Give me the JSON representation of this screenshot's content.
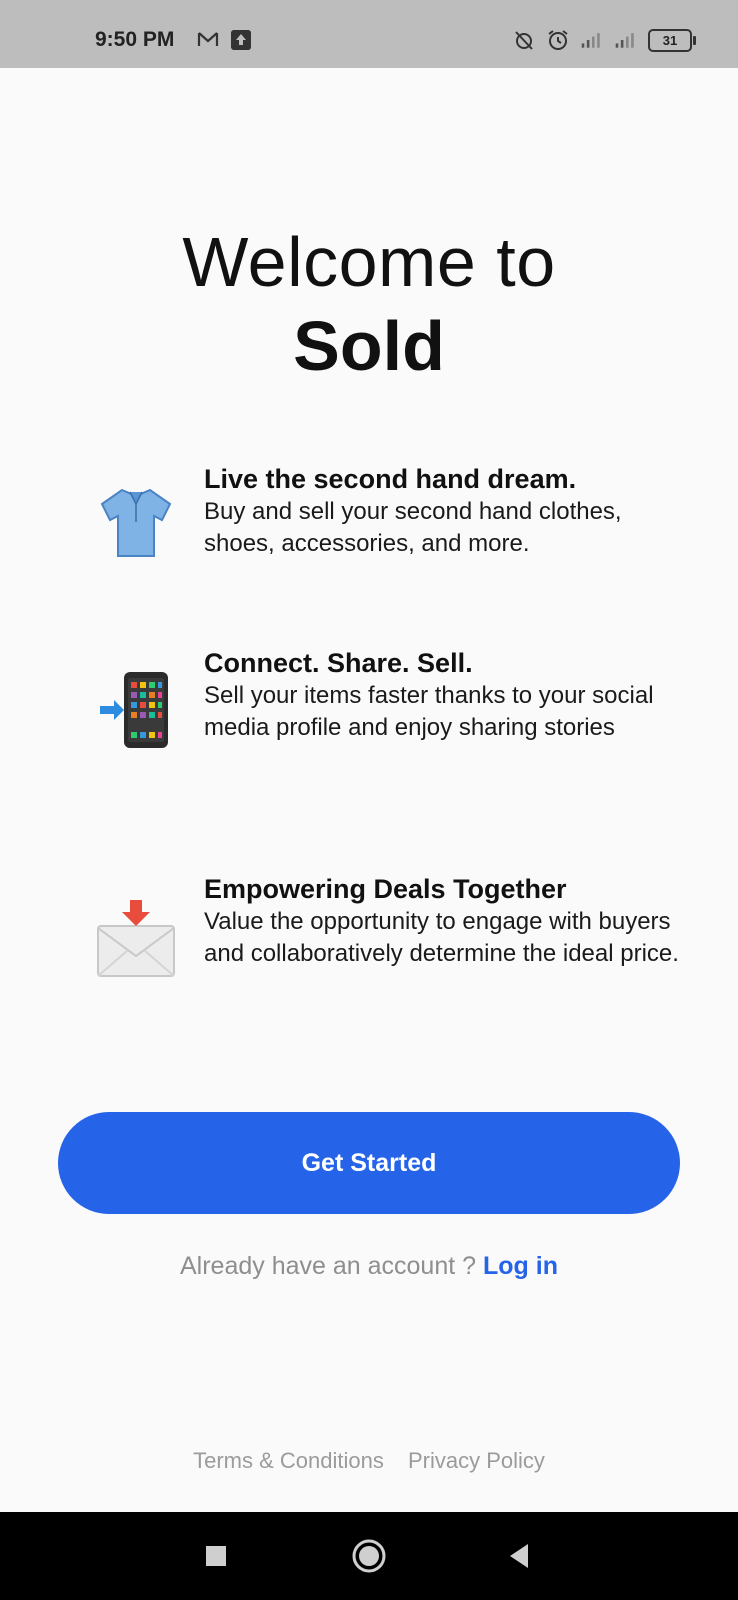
{
  "status_bar": {
    "time": "9:50 PM",
    "battery": "31",
    "icons": [
      "gmail-icon",
      "upload-icon",
      "alarm-off-icon",
      "alarm-icon",
      "signal-icon",
      "signal-icon",
      "battery-icon"
    ]
  },
  "welcome": {
    "line1": "Welcome to",
    "brand": "Sold"
  },
  "features": [
    {
      "icon": "t-shirt-icon",
      "title": "Live the second hand dream.",
      "description": "Buy and sell your second hand clothes, shoes, accessories, and more."
    },
    {
      "icon": "phone-arrow-icon",
      "title": "Connect. Share. Sell.",
      "description": "Sell your items faster thanks to your social media profile and enjoy sharing stories"
    },
    {
      "icon": "envelope-arrow-icon",
      "title": "Empowering Deals Together",
      "description": "Value the opportunity to engage with buyers and collaboratively determine the ideal price."
    }
  ],
  "cta": {
    "label": "Get Started"
  },
  "login": {
    "prompt": "Already have an account ?",
    "link": "Log in"
  },
  "footer": {
    "terms": "Terms & Conditions",
    "privacy": "Privacy Policy"
  },
  "colors": {
    "accent": "#2563e8",
    "background": "#fafafa",
    "status_bar": "#bdbdbd"
  }
}
